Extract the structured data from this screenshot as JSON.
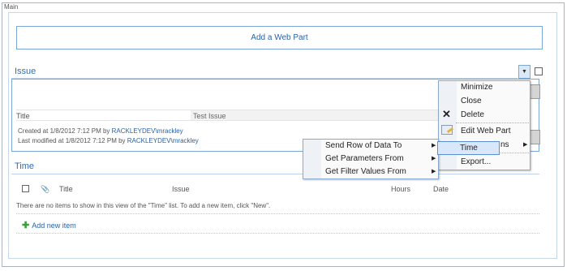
{
  "zone": {
    "label": "Main",
    "add_web_part": "Add a Web Part"
  },
  "issue": {
    "title": "Issue",
    "field_label": "Title",
    "field_value": "Test Issue",
    "created_prefix": "Created at 1/8/2012 7:12 PM  by ",
    "created_user": "RACKLEYDEV\\mrackley",
    "modified_prefix": "Last modified at 1/8/2012 7:12 PM  by ",
    "modified_user": "RACKLEYDEV\\mrackley",
    "dropdown_icon": "chevron-down-icon"
  },
  "webpart_menu": {
    "items": [
      "Minimize",
      "Close",
      "Delete",
      "Edit Web Part",
      "Connections",
      "Export..."
    ],
    "visible_connections_tail": "ns",
    "icons": [
      "delete-x-icon",
      "edit-web-part-icon"
    ]
  },
  "connections_submenu": {
    "items": [
      "Send Row of Data To",
      "Get Parameters From",
      "Get Filter Values From"
    ]
  },
  "time_target": {
    "label": "Time"
  },
  "time": {
    "title": "Time",
    "columns": [
      "Title",
      "Issue",
      "Hours",
      "Date"
    ],
    "empty_message": "There are no items to show in this view of the \"Time\" list. To add a new item, click \"New\".",
    "add_new": "Add new item"
  }
}
